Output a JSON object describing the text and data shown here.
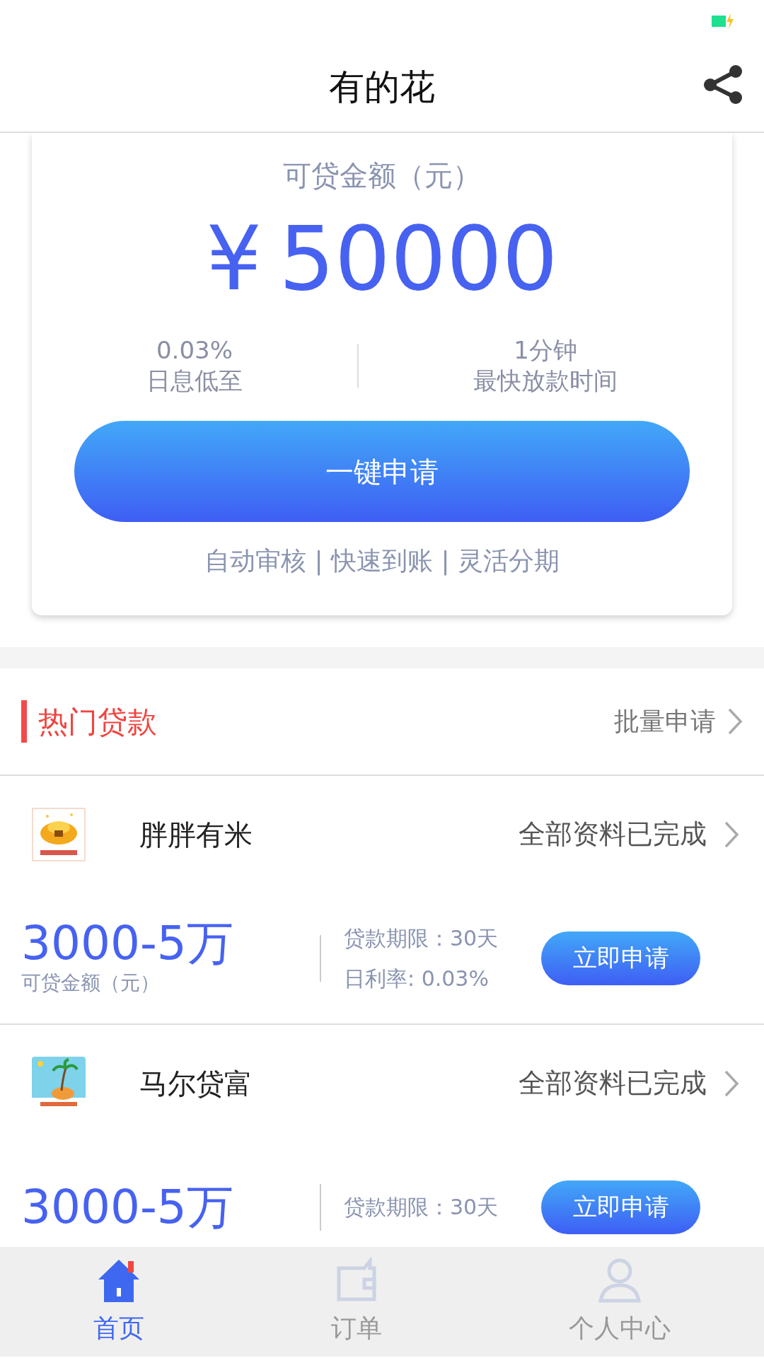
{
  "header": {
    "title": "有的花"
  },
  "quota_card": {
    "label": "可贷金额（元）",
    "currency": "¥",
    "amount": "50000",
    "stats": [
      {
        "value": "0.03%",
        "label": "日息低至"
      },
      {
        "value": "1分钟",
        "label": "最快放款时间"
      }
    ],
    "button": "一键申请",
    "features": "自动审核 | 快速到账 | 灵活分期"
  },
  "hot_loans": {
    "title": "热门贷款",
    "more": "批量申请",
    "items": [
      {
        "name": "胖胖有米",
        "status": "全部资料已完成",
        "amount": "3000-5万",
        "amount_label": "可贷金额（元）",
        "term": "贷款期限：30天",
        "rate": "日利率: 0.03%",
        "button": "立即申请"
      },
      {
        "name": "马尔贷富",
        "status": "全部资料已完成",
        "amount": "3000-5万",
        "term": "贷款期限：30天",
        "button": "立即申请"
      }
    ]
  },
  "tab_bar": [
    {
      "label": "首页",
      "selected": true
    },
    {
      "label": "订单",
      "selected": false
    },
    {
      "label": "个人中心",
      "selected": false
    }
  ]
}
